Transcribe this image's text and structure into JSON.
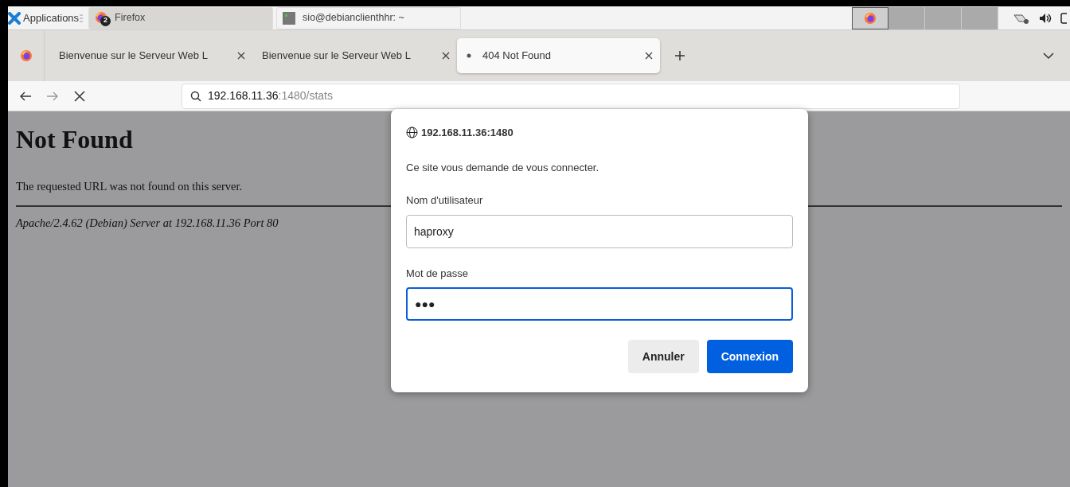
{
  "taskbar": {
    "menu_label": "Applications",
    "tasks": [
      {
        "label": "Firefox",
        "badge": "2",
        "kind": "browser",
        "selected": true
      },
      {
        "label": "sio@debianclienthhr: ~",
        "kind": "terminal",
        "selected": false
      }
    ],
    "workspaces": [
      {
        "selected": true
      },
      {
        "selected": false
      },
      {
        "selected": false
      },
      {
        "selected": false
      }
    ]
  },
  "tabs": [
    {
      "label": "Bienvenue sur le Serveur Web L",
      "selected": false,
      "loading": false
    },
    {
      "label": "Bienvenue sur le Serveur Web L",
      "selected": false,
      "loading": false
    },
    {
      "label": "404 Not Found",
      "selected": true,
      "loading": true
    }
  ],
  "address": {
    "host": "192.168.11.36",
    "rest": ":1480/stats"
  },
  "page": {
    "heading": "Not Found",
    "message": "The requested URL was not found on this server.",
    "footer": "Apache/2.4.62 (Debian) Server at 192.168.11.36 Port 80"
  },
  "dialog": {
    "origin": "192.168.11.36:1480",
    "prompt": "Ce site vous demande de vous connecter.",
    "fields": [
      {
        "label": "Nom d'utilisateur",
        "value": "haproxy",
        "focused": false
      },
      {
        "label": "Mot de passe",
        "value": "●●●",
        "focused": true
      }
    ],
    "buttons": [
      {
        "label": "Annuler",
        "kind": "secondary"
      },
      {
        "label": "Connexion",
        "kind": "primary"
      }
    ]
  }
}
